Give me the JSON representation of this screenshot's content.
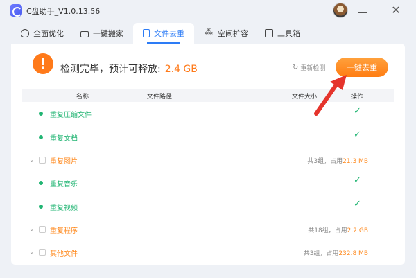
{
  "app": {
    "title": "C盘助手_V1.0.13.56"
  },
  "window": {
    "menu_icon": "hamburger-menu-icon",
    "minimize_icon": "minimize-icon",
    "close_icon": "close-icon",
    "close_glyph": "✕"
  },
  "tabs": [
    {
      "label": "全面优化",
      "icon": "clean-icon",
      "active": false
    },
    {
      "label": "一键搬家",
      "icon": "truck-icon",
      "active": false
    },
    {
      "label": "文件去重",
      "icon": "file-icon",
      "active": true
    },
    {
      "label": "空间扩容",
      "icon": "expand-icon",
      "active": false
    },
    {
      "label": "工具箱",
      "icon": "toolbox-icon",
      "active": false
    }
  ],
  "status": {
    "text": "检测完毕，预计可释放:",
    "size": "2.4 GB",
    "warn_glyph": "!"
  },
  "rescan": {
    "label": "重新检测",
    "glyph": "↻"
  },
  "dedup_button": {
    "label": "一键去重"
  },
  "table": {
    "headers": {
      "name": "名称",
      "path": "文件路径",
      "size": "文件大小",
      "action": "操作"
    },
    "rows": [
      {
        "name": "重复压缩文件",
        "style": "green",
        "check": "✓"
      },
      {
        "name": "重复文档",
        "style": "green",
        "check": "✓"
      },
      {
        "name": "重复图片",
        "style": "orange",
        "chevron": "⌄",
        "groups_pre": "共3组，占用",
        "groups_val": "21.3 MB"
      },
      {
        "name": "重复音乐",
        "style": "green",
        "check": "✓"
      },
      {
        "name": "重复视频",
        "style": "green",
        "check": "✓"
      },
      {
        "name": "重复程序",
        "style": "orange",
        "chevron": "⌄",
        "groups_pre": "共18组，占用",
        "groups_val": "2.2 GB"
      },
      {
        "name": "其他文件",
        "style": "orange",
        "chevron": "⌄",
        "groups_pre": "共3组，占用",
        "groups_val": "232.8 MB"
      }
    ]
  },
  "colors": {
    "accent": "#2d7cf6",
    "orange": "#ff7a1a",
    "green": "#22b573",
    "arrow": "#e5342c"
  }
}
